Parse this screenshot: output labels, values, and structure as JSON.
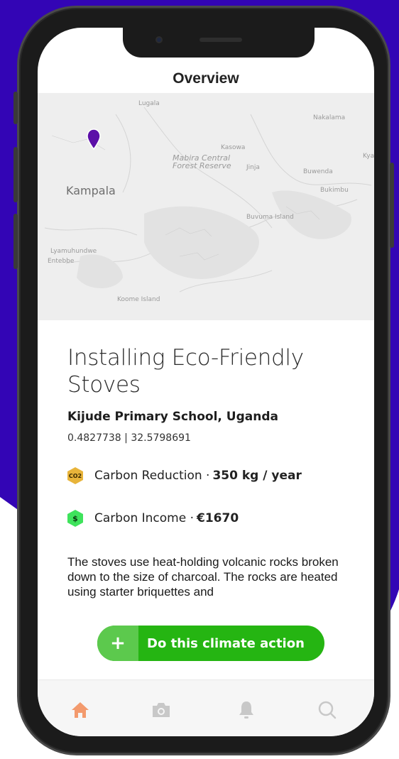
{
  "header": {
    "title": "Overview"
  },
  "map": {
    "labels": [
      {
        "name": "label-lugala",
        "text": "Lugala"
      },
      {
        "name": "label-nakalama",
        "text": "Nakalama"
      },
      {
        "name": "label-kasowa",
        "text": "Kasowa"
      },
      {
        "name": "label-mabira",
        "text": "Mabira Central\nForest Reserve"
      },
      {
        "name": "label-jinja",
        "text": "Jinja"
      },
      {
        "name": "label-kampala",
        "text": "Kampala"
      },
      {
        "name": "label-buwenge",
        "text": "Buwenda"
      },
      {
        "name": "label-bukimbu",
        "text": "Bukimbu"
      },
      {
        "name": "label-kyampisi",
        "text": "Kyampisi"
      },
      {
        "name": "label-buvuma",
        "text": "Buvuma Island"
      },
      {
        "name": "label-lyamuhundwe",
        "text": "Lyamuhundwe"
      },
      {
        "name": "label-entebbe",
        "text": "Entebbe"
      },
      {
        "name": "label-koome",
        "text": "Koome Island"
      }
    ]
  },
  "action": {
    "title": "Installing Eco-Friendly Stoves",
    "location": "Kijude Primary School, Uganda",
    "coordinates": "0.4827738 | 32.5798691",
    "carbon_reduction": {
      "icon_text": "CO2",
      "label": "Carbon Reduction · ",
      "value": "350 kg / year"
    },
    "carbon_income": {
      "icon_text": "$",
      "label": "Carbon Income · ",
      "value": "€1670"
    },
    "description": "The stoves use heat-holding volcanic rocks broken down to the size of charcoal. The rocks are heated using starter briquettes and",
    "cta": {
      "plus": "+",
      "label": "Do this climate action"
    }
  },
  "colors": {
    "background_blob": "#3305b5",
    "cta_green": "#25b512",
    "pin_purple": "#5c0fa8",
    "reduction_icon": "#e8b43a",
    "income_icon": "#3fe35c",
    "active_tab": "#f39a6d",
    "inactive_tab": "#c8c8c8"
  },
  "tabs": [
    {
      "name": "home-tab",
      "icon": "home-icon",
      "active": true
    },
    {
      "name": "camera-tab",
      "icon": "camera-icon",
      "active": false
    },
    {
      "name": "notifications-tab",
      "icon": "bell-icon",
      "active": false
    },
    {
      "name": "search-tab",
      "icon": "search-icon",
      "active": false
    }
  ]
}
